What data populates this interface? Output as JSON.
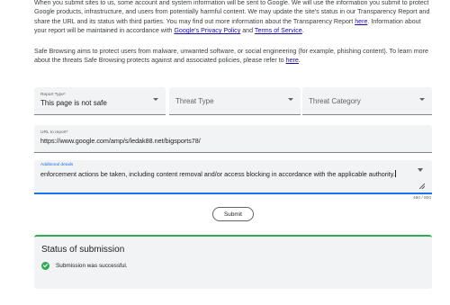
{
  "intro": {
    "p1_a": "When you submit sites to us, some account and system information will be sent to Google. We will use the information you submit to protect Google products, infrastructure, and users from potentially harmful content. We may update the site's status in our Transparency Report and share the URL and its status with third parties. You may find out more information about the Transparency Report ",
    "p1_here": "here",
    "p1_b": ". Information about your report will be maintained in accordance with ",
    "p1_privacy": "Google's Privacy Policy",
    "p1_and": " and ",
    "p1_terms": "Terms of Service",
    "p1_end": ".",
    "p2_a": "Safe Browsing aims to protect users from malware, unwanted software, or social engineering (for example, phishing content). To learn more about the threats Safe Browsing protects against and associated policies, please refer to ",
    "p2_here": "here",
    "p2_end": "."
  },
  "form": {
    "report_type_label": "Report Type*",
    "report_type_value": "This page is not safe",
    "threat_type_placeholder": "Threat Type",
    "threat_category_placeholder": "Threat Category",
    "url_label": "URL to report*",
    "url_value": "https://www.google.com/amp/s/ledak88.net/bigsports78/",
    "details_label": "Additional details",
    "details_value": "enforcement actions be taken, including content removal and/or access blocking in accordance with the applicable authority.",
    "char_count": "480 / 800",
    "submit_label": "Submit"
  },
  "status": {
    "title": "Status of submission",
    "message": "Submission was successful."
  },
  "colors": {
    "accent": "#1a73e8",
    "success": "#34a853",
    "field_bg": "#f1f3f4"
  }
}
